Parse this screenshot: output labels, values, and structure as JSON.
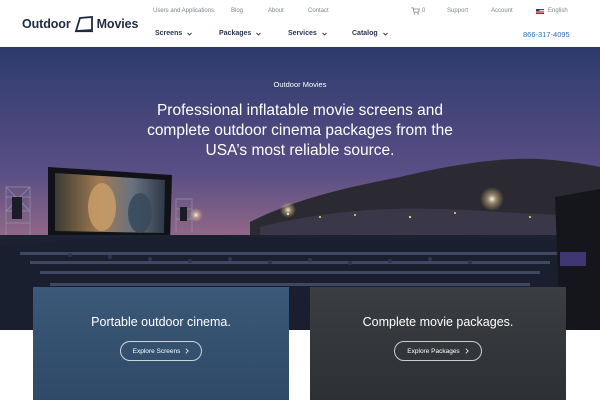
{
  "header": {
    "logo": {
      "left": "Outdoor",
      "right": "Movies"
    },
    "utility": [
      "Users and Applications",
      "Blog",
      "About",
      "Contact"
    ],
    "cart_count": "0",
    "support": "Support",
    "account": "Account",
    "language": "English",
    "nav": [
      "Screens",
      "Packages",
      "Services",
      "Catalog"
    ],
    "phone": "866-317-4095"
  },
  "hero": {
    "eyebrow": "Outdoor Movies",
    "title": "Professional inflatable movie screens and complete outdoor cinema packages from the USA’s most reliable source."
  },
  "cards": [
    {
      "title": "Portable outdoor cinema.",
      "button": "Explore Screens",
      "color": "#34506f"
    },
    {
      "title": "Complete movie packages.",
      "button": "Explore Packages",
      "color": "#313438"
    }
  ]
}
